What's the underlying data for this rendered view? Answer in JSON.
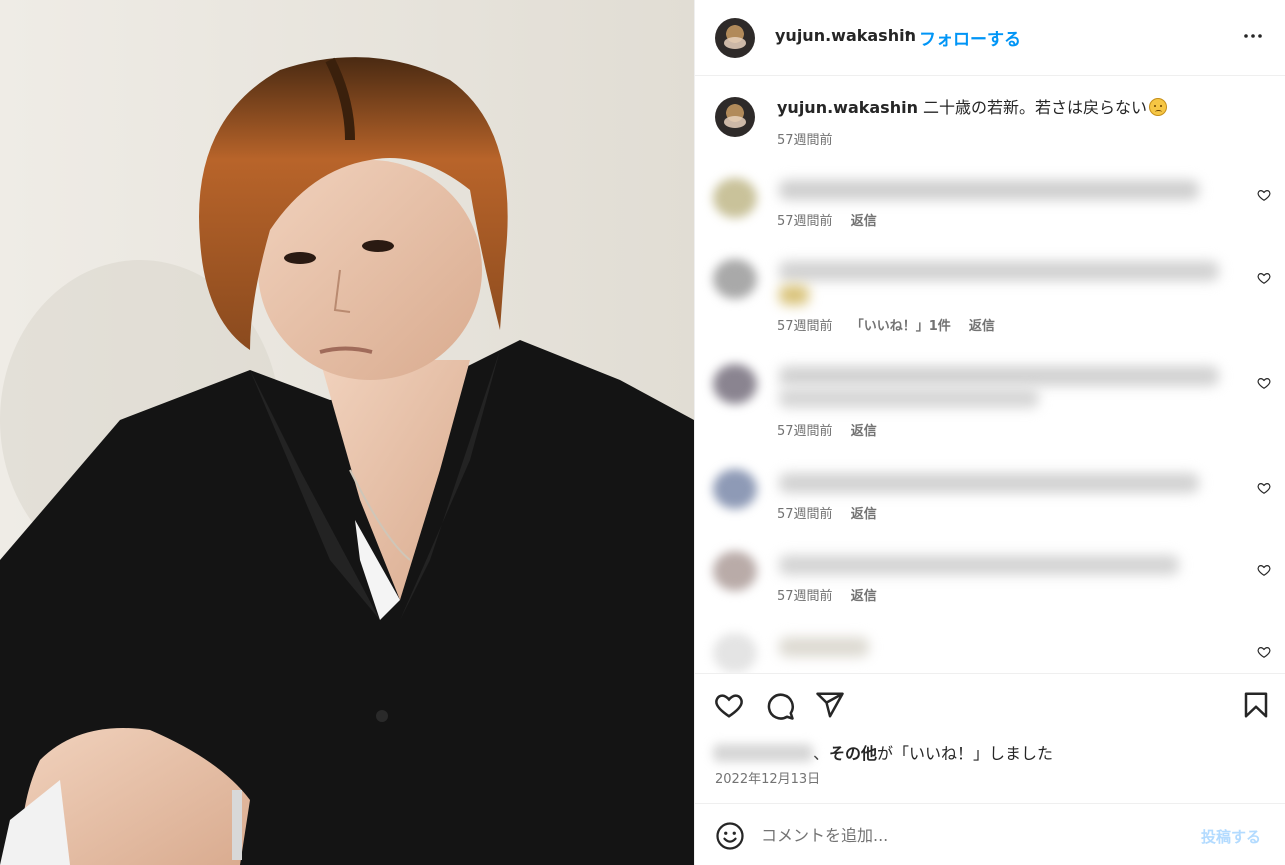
{
  "post": {
    "username": "yujun.wakashin",
    "separator": "•",
    "follow_label": "フォローする",
    "more_icon": "more-horizontal-icon"
  },
  "caption": {
    "username": "yujun.wakashin",
    "text": " 二十歳の若新。若さは戻らない",
    "emoji": "frowning-face-emoji",
    "time": "57週間前"
  },
  "comments": [
    {
      "time": "57週間前",
      "likes": "",
      "reply": "返信"
    },
    {
      "time": "57週間前",
      "likes": "「いいね！」1件",
      "reply": "返信"
    },
    {
      "time": "57週間前",
      "likes": "",
      "reply": "返信"
    },
    {
      "time": "57週間前",
      "likes": "",
      "reply": "返信"
    },
    {
      "time": "57週間前",
      "likes": "",
      "reply": "返信"
    }
  ],
  "actions": {
    "like_icon": "heart-icon",
    "comment_icon": "comment-icon",
    "share_icon": "share-icon",
    "save_icon": "bookmark-icon",
    "likes_separator": "、",
    "likes_bold": "その他",
    "likes_rest": "が「いいね！」しました",
    "date": "2022年12月13日"
  },
  "add_comment": {
    "placeholder": "コメントを追加...",
    "post_label": "投稿する"
  },
  "colors": {
    "accent": "#0095f6",
    "muted": "#737373",
    "post_disabled": "#b3dbff"
  }
}
